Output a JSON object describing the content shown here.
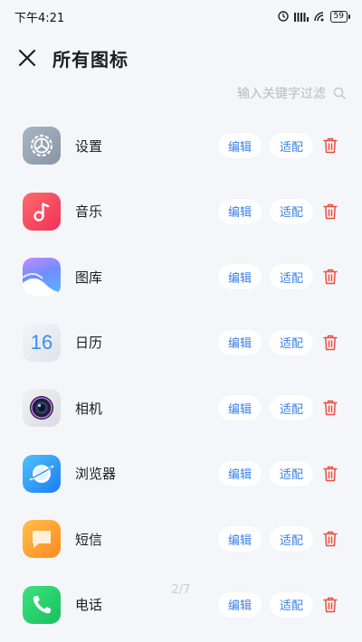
{
  "status_bar": {
    "time": "下午4:21",
    "battery": "59"
  },
  "header": {
    "title": "所有图标"
  },
  "search": {
    "placeholder": "输入关键字过滤"
  },
  "apps": [
    {
      "name": "设置",
      "edit_label": "编辑",
      "adapt_label": "适配"
    },
    {
      "name": "音乐",
      "edit_label": "编辑",
      "adapt_label": "适配"
    },
    {
      "name": "图库",
      "edit_label": "编辑",
      "adapt_label": "适配"
    },
    {
      "name": "日历",
      "edit_label": "编辑",
      "adapt_label": "适配",
      "icon_text": "16"
    },
    {
      "name": "相机",
      "edit_label": "编辑",
      "adapt_label": "适配"
    },
    {
      "name": "浏览器",
      "edit_label": "编辑",
      "adapt_label": "适配"
    },
    {
      "name": "短信",
      "edit_label": "编辑",
      "adapt_label": "适配"
    },
    {
      "name": "电话",
      "edit_label": "编辑",
      "adapt_label": "适配"
    }
  ],
  "pager": {
    "text": "2/7"
  },
  "colors": {
    "accent": "#3a7fe8",
    "delete": "#e8503f",
    "background": "#f5f6fa"
  }
}
